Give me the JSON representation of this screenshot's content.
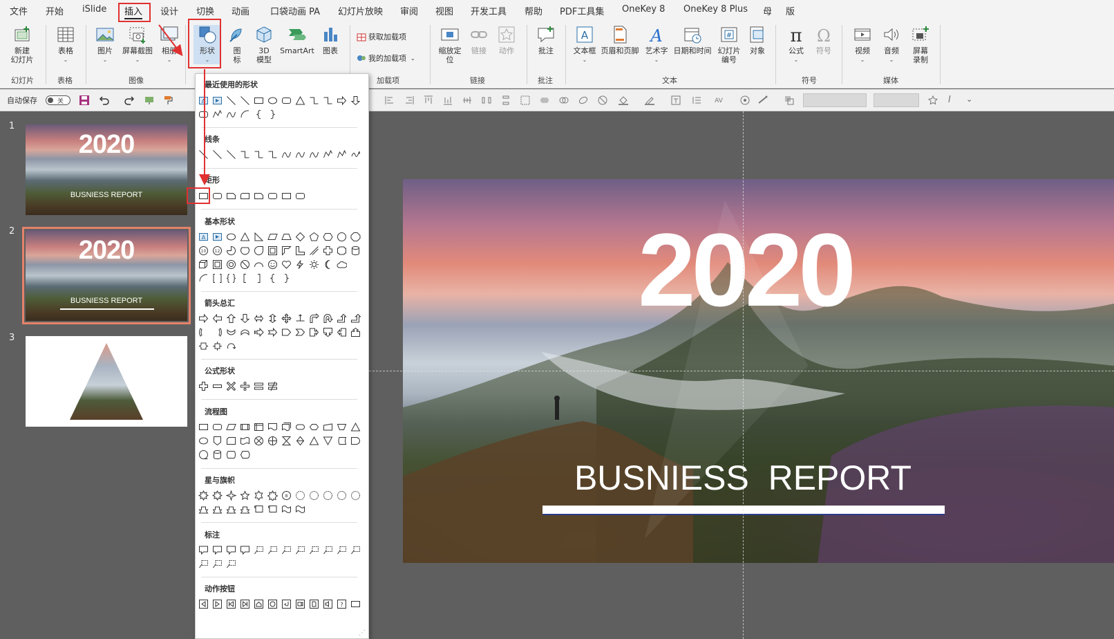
{
  "menu_tabs": [
    "文件",
    "开始",
    "iSlide",
    "插入",
    "设计",
    "切换",
    "动画",
    "口袋动画 PA",
    "幻灯片放映",
    "审阅",
    "视图",
    "开发工具",
    "帮助",
    "PDF工具集",
    "OneKey 8",
    "OneKey 8 Plus",
    "母",
    "版"
  ],
  "active_tab": "插入",
  "ribbon": {
    "new_slide": "新建\n幻灯片",
    "table": "表格",
    "picture": "图片",
    "screenshot": "屏幕截图",
    "album": "相册",
    "shapes": "形状",
    "icons": "图\n标",
    "model3d": "3D\n模型",
    "smartart": "SmartArt",
    "chart": "图表",
    "get_addins": "获取加载项",
    "my_addins": "我的加载项",
    "zoom": "缩放定\n位",
    "link": "链接",
    "action": "动作",
    "comment": "批注",
    "textbox": "文本框",
    "header_footer": "页眉和页脚",
    "wordart": "艺术字",
    "datetime": "日期和时间",
    "slide_number": "幻灯片\n编号",
    "object": "对象",
    "equation": "公式",
    "symbol": "符号",
    "video": "视频",
    "audio": "音频",
    "screen_record": "屏幕\n录制",
    "groups": {
      "slides": "幻灯片",
      "tables": "表格",
      "images": "图像",
      "addins": "加载项",
      "links": "链接",
      "comments": "批注",
      "text": "文本",
      "symbols": "符号",
      "media": "媒体"
    }
  },
  "qat": {
    "autosave_label": "自动保存",
    "autosave_state": "关"
  },
  "slides": [
    {
      "num": "1",
      "year": "2020",
      "sub": "BUSNIESS  REPORT"
    },
    {
      "num": "2",
      "year": "2020",
      "sub": "BUSNIESS  REPORT"
    },
    {
      "num": "3"
    }
  ],
  "main_slide": {
    "year": "2020",
    "subtitle": "BUSNIESS  REPORT"
  },
  "shapes_panel": {
    "sections": [
      "最近使用的形状",
      "线条",
      "矩形",
      "基本形状",
      "箭头总汇",
      "公式形状",
      "流程图",
      "星与旗帜",
      "标注",
      "动作按钮"
    ]
  },
  "colors": {
    "highlight": "#e03030",
    "selected_thumb": "#e5826a",
    "ribbon_bg": "#f3f3f3",
    "canvas_bg": "#5f5f5f"
  }
}
